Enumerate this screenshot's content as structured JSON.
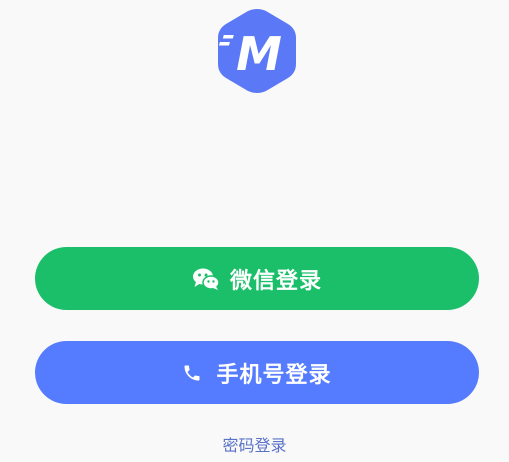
{
  "logo": {
    "icon": "app-logo-m-icon",
    "letter": "M",
    "color": "#5b79f6"
  },
  "login": {
    "wechat_label": "微信登录",
    "wechat_icon": "wechat-icon",
    "wechat_color": "#1bbf69",
    "phone_label": "手机号登录",
    "phone_icon": "phone-icon",
    "phone_color": "#557bff",
    "password_link": "密码登录"
  }
}
